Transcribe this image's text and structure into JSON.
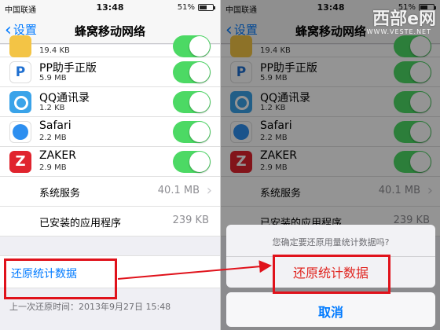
{
  "status_bar": {
    "carrier": "中国联通",
    "time": "13:48",
    "battery": "51%",
    "battery_level": 0.51
  },
  "nav": {
    "back_label": "设置",
    "title": "蜂窝移动网络"
  },
  "apps": [
    {
      "name": "",
      "size": "19.4 KB",
      "icon": "yellow-app-icon",
      "enabled": true
    },
    {
      "name": "PP助手正版",
      "size": "5.9 MB",
      "icon": "pp-assistant-icon",
      "glyph": "P",
      "enabled": true
    },
    {
      "name": "QQ通讯录",
      "size": "1.2 KB",
      "icon": "qq-contacts-icon",
      "enabled": true
    },
    {
      "name": "Safari",
      "size": "2.2 MB",
      "icon": "safari-compass-icon",
      "enabled": true
    },
    {
      "name": "ZAKER",
      "size": "2.9 MB",
      "icon": "zaker-icon",
      "glyph": "Z",
      "enabled": true
    }
  ],
  "system_services": {
    "label": "系统服务",
    "value": "40.1 MB"
  },
  "installed_apps": {
    "label": "已安装的应用程序",
    "value": "239 KB"
  },
  "reset": {
    "label": "还原统计数据",
    "last_reset": "上一次还原时间：2013年9月27日 15:48"
  },
  "dialog": {
    "prompt": "您确定要还原用量统计数据吗?",
    "confirm": "还原统计数据",
    "cancel": "取消"
  },
  "watermark": {
    "text": "西部e网",
    "url": "WWW.VESTE.NET"
  },
  "colors": {
    "ios_blue": "#007aff",
    "switch_green": "#4cd964",
    "highlight_red": "#e0121b",
    "destructive_red": "#e0241f"
  }
}
